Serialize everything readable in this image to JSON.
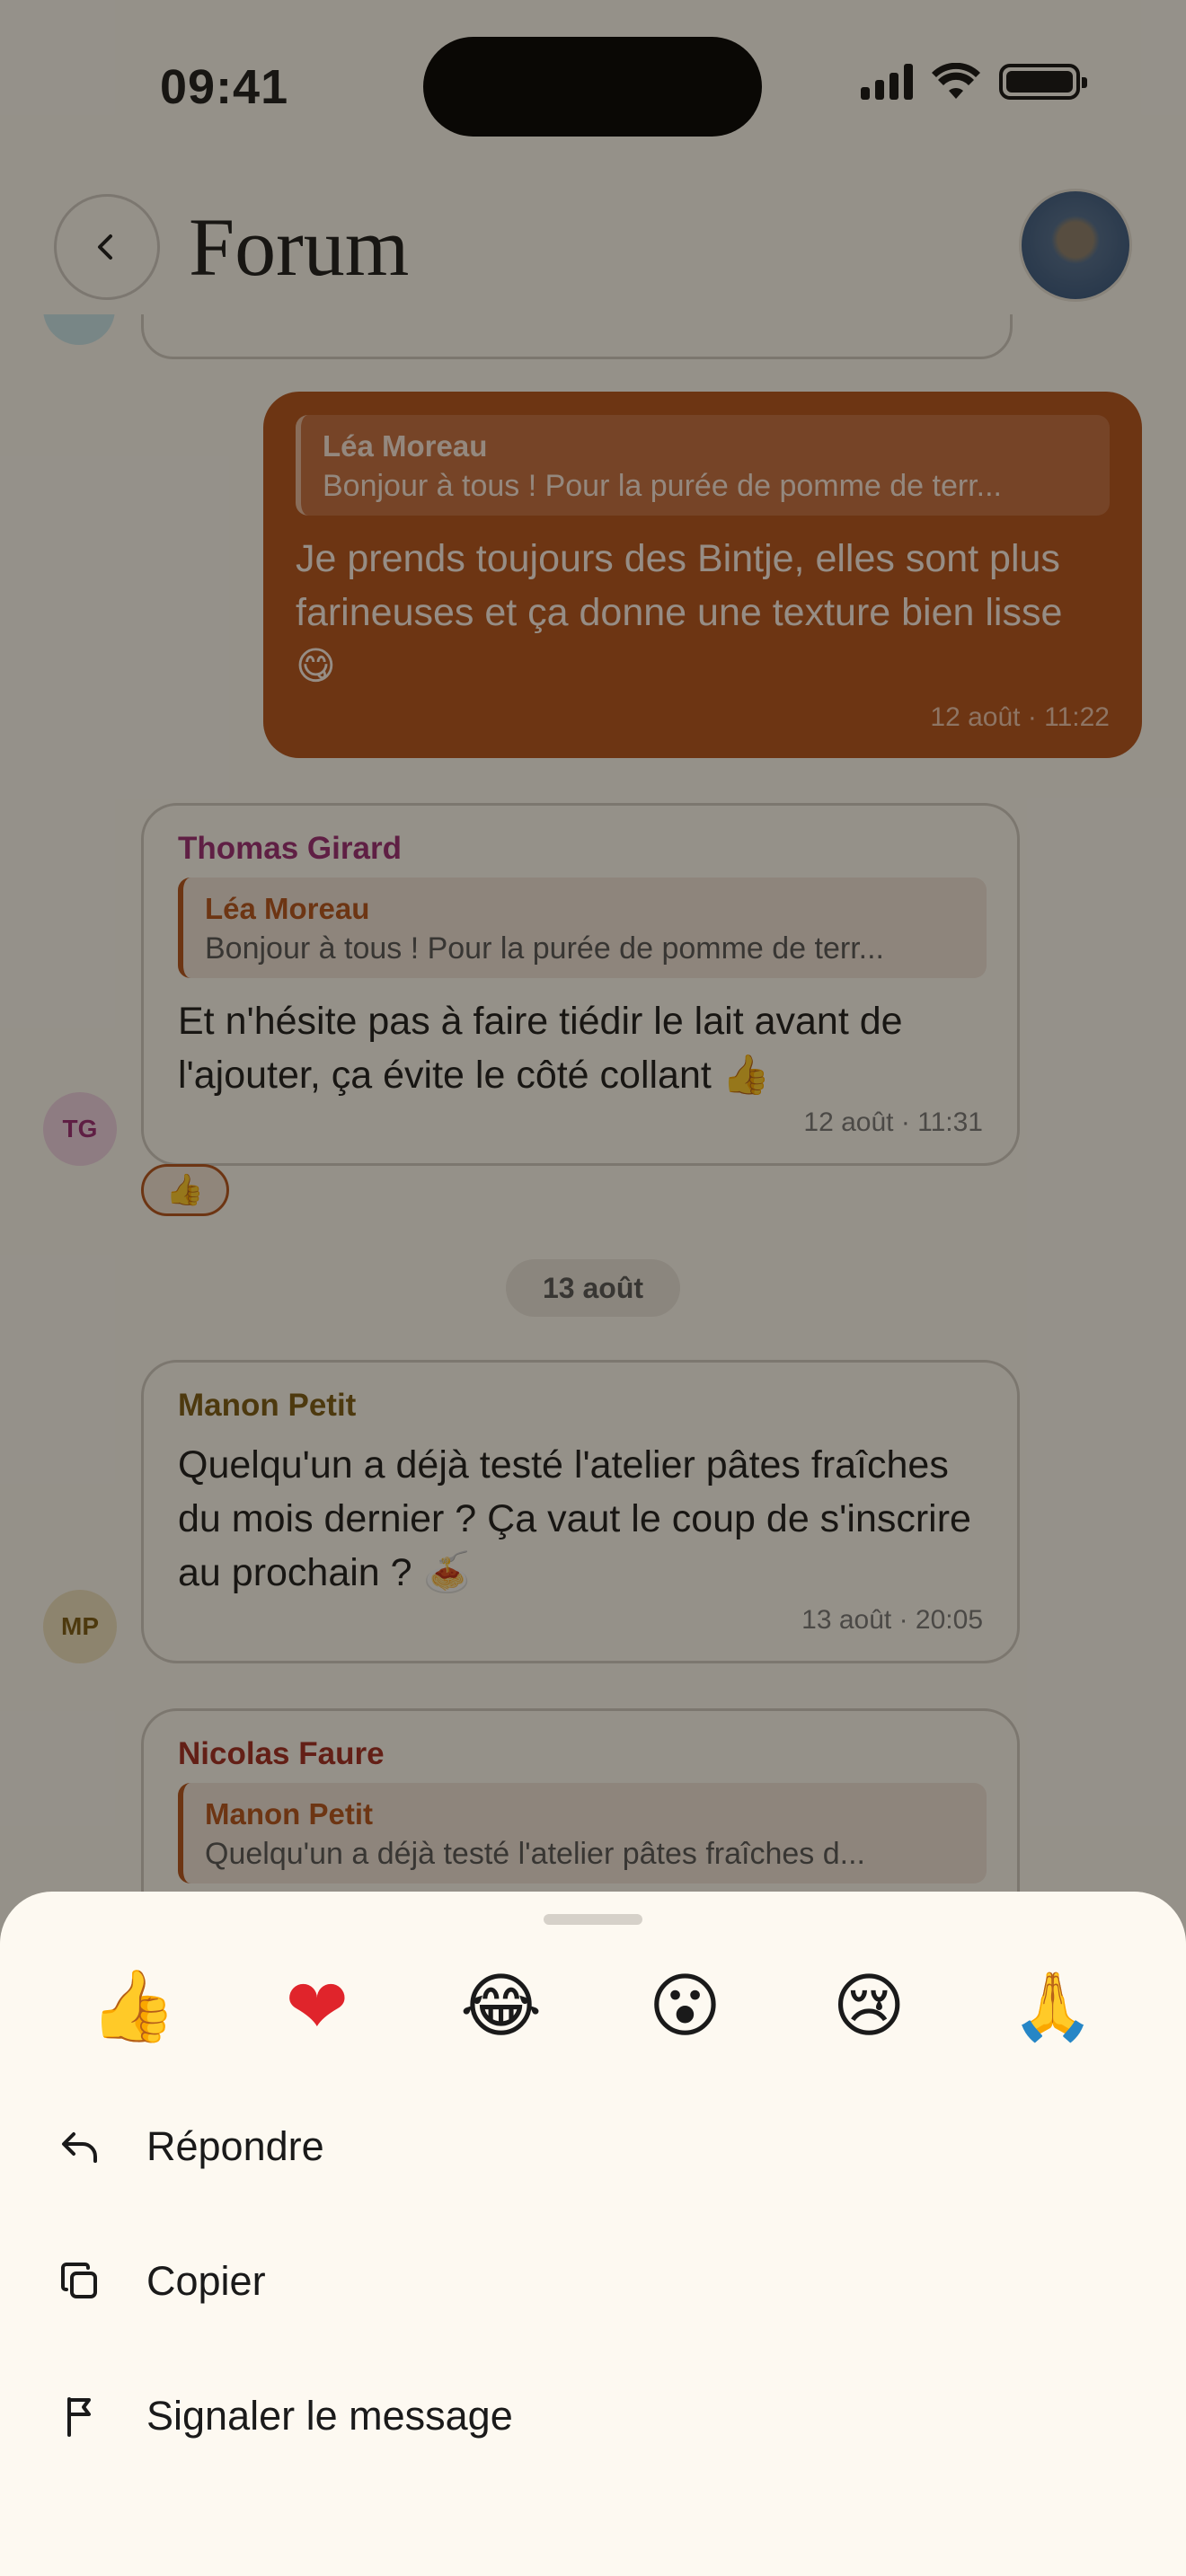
{
  "status_bar": {
    "time": "09:41"
  },
  "header": {
    "title": "Forum"
  },
  "messages": {
    "outgoing": {
      "quote_author": "Léa Moreau",
      "quote_text": "Bonjour à tous ! Pour la purée de pomme de terr...",
      "text": "Je prends toujours des Bintje, elles sont plus farineuses et ça donne une texture bien lisse 😋",
      "timestamp": "12 août · 11:22"
    },
    "thomas": {
      "avatar_initials": "TG",
      "sender": "Thomas Girard",
      "quote_author": "Léa Moreau",
      "quote_text": "Bonjour à tous ! Pour la purée de pomme de terr...",
      "text": "Et n'hésite pas à faire tiédir le lait avant de l'ajouter, ça évite le côté collant 👍",
      "timestamp": "12 août · 11:31",
      "reaction": "👍"
    },
    "date_separator": "13 août",
    "manon": {
      "avatar_initials": "MP",
      "sender": "Manon Petit",
      "text": "Quelqu'un a déjà testé l'atelier pâtes fraîches du mois dernier ? Ça vaut le coup de s'inscrire au prochain ? 🍝",
      "timestamp": "13 août · 20:05"
    },
    "nicolas": {
      "sender": "Nicolas Faure",
      "quote_author": "Manon Petit",
      "quote_text": "Quelqu'un a déjà testé l'atelier pâtes fraîches d..."
    }
  },
  "sheet": {
    "reactions": [
      "👍",
      "❤",
      "😂",
      "😮",
      "😢",
      "🙏"
    ],
    "actions": {
      "reply": "Répondre",
      "copy": "Copier",
      "report": "Signaler le message"
    }
  },
  "colors": {
    "accent": "#b4521b",
    "thomas_name": "#9c2a73",
    "manon_name": "#7a5a12",
    "nicolas_name": "#a32a20",
    "sheet_bg": "#fdf9f1"
  }
}
